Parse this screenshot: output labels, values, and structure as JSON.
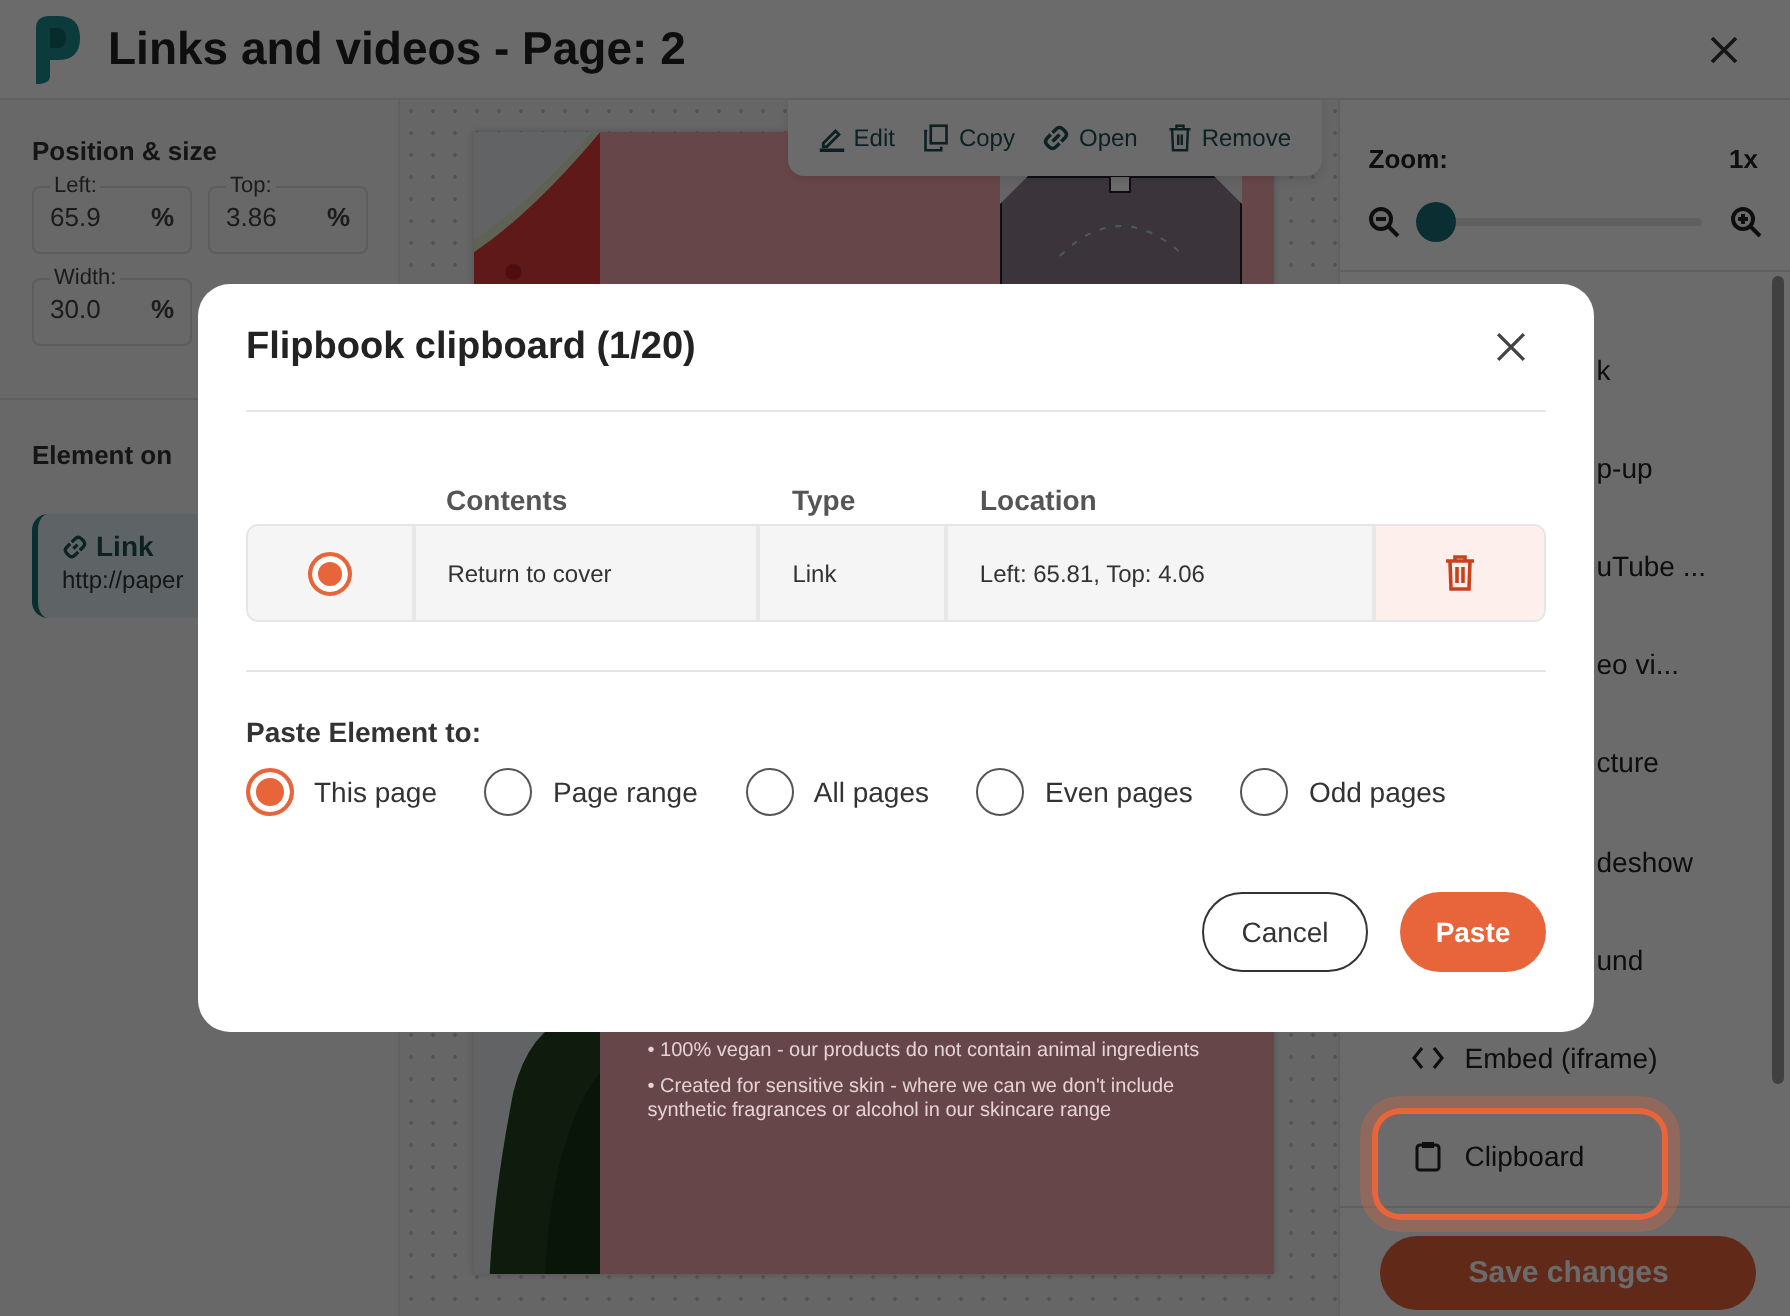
{
  "window": {
    "title": "Links and videos - Page: 2"
  },
  "toolbar": [
    {
      "kind": "edit",
      "label": "Edit"
    },
    {
      "kind": "copy",
      "label": "Copy"
    },
    {
      "kind": "open",
      "label": "Open"
    },
    {
      "kind": "remove",
      "label": "Remove"
    }
  ],
  "position_size": {
    "title": "Position & size",
    "fields": [
      {
        "label": "Left:",
        "value": "65.9",
        "unit": "%"
      },
      {
        "label": "Top:",
        "value": "3.86",
        "unit": "%"
      },
      {
        "label": "Width:",
        "value": "30.0",
        "unit": "%"
      }
    ]
  },
  "element_on": {
    "title": "Element on",
    "item": {
      "type": "Link",
      "url": "http://paper"
    }
  },
  "page_text": [
    "• 100% vegan - our products do not contain animal ingredients",
    "• Created for sensitive skin - where we can we don't include synthetic fragrances or alcohol in our skincare range"
  ],
  "zoom": {
    "label": "Zoom:",
    "value": "1x",
    "level": 0
  },
  "element_types": [
    {
      "label": "k",
      "kind": "cut",
      "highlighted": false
    },
    {
      "label": "p-up",
      "kind": "cut",
      "highlighted": false
    },
    {
      "label": "uTube ...",
      "kind": "cut",
      "highlighted": false
    },
    {
      "label": "eo vi...",
      "kind": "cut",
      "highlighted": false
    },
    {
      "label": "cture",
      "kind": "cut",
      "highlighted": false
    },
    {
      "label": "deshow",
      "kind": "cut",
      "highlighted": false
    },
    {
      "label": "und",
      "kind": "cut",
      "highlighted": false
    },
    {
      "label": "Embed (iframe)",
      "kind": "embed",
      "highlighted": false
    },
    {
      "label": "Clipboard",
      "kind": "clipboard",
      "highlighted": true
    }
  ],
  "save_button": "Save changes",
  "dialog": {
    "title": "Flipbook clipboard (1/20)",
    "columns": [
      "Contents",
      "Type",
      "Location"
    ],
    "rows": [
      {
        "selected": true,
        "contents": "Return to cover",
        "type": "Link",
        "location": "Left: 65.81, Top: 4.06"
      }
    ],
    "paste_label": "Paste Element to:",
    "paste_options": [
      {
        "label": "This page",
        "selected": true
      },
      {
        "label": "Page range",
        "selected": false
      },
      {
        "label": "All pages",
        "selected": false
      },
      {
        "label": "Even pages",
        "selected": false
      },
      {
        "label": "Odd pages",
        "selected": false
      }
    ],
    "cancel": "Cancel",
    "paste": "Paste"
  }
}
